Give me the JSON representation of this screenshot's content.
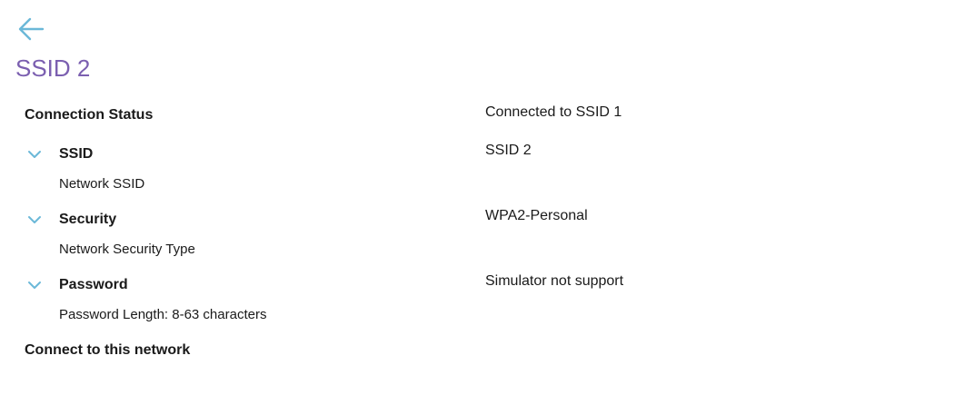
{
  "header": {
    "back_icon": "arrow-left-icon",
    "title": "SSID 2"
  },
  "colors": {
    "accent": "#6bb8d8",
    "title": "#7b5fb0",
    "text": "#1a1a1a"
  },
  "connection_status": {
    "label": "Connection Status",
    "value": "Connected to SSID 1"
  },
  "ssid": {
    "label": "SSID",
    "description": "Network SSID",
    "value": "SSID 2",
    "icon": "chevron-down-icon"
  },
  "security": {
    "label": "Security",
    "description": "Network Security Type",
    "value": "WPA2-Personal",
    "icon": "chevron-down-icon"
  },
  "password": {
    "label": "Password",
    "description": "Password Length: 8-63 characters",
    "value": "Simulator not support",
    "icon": "chevron-down-icon"
  },
  "actions": {
    "connect_label": "Connect to this network"
  }
}
